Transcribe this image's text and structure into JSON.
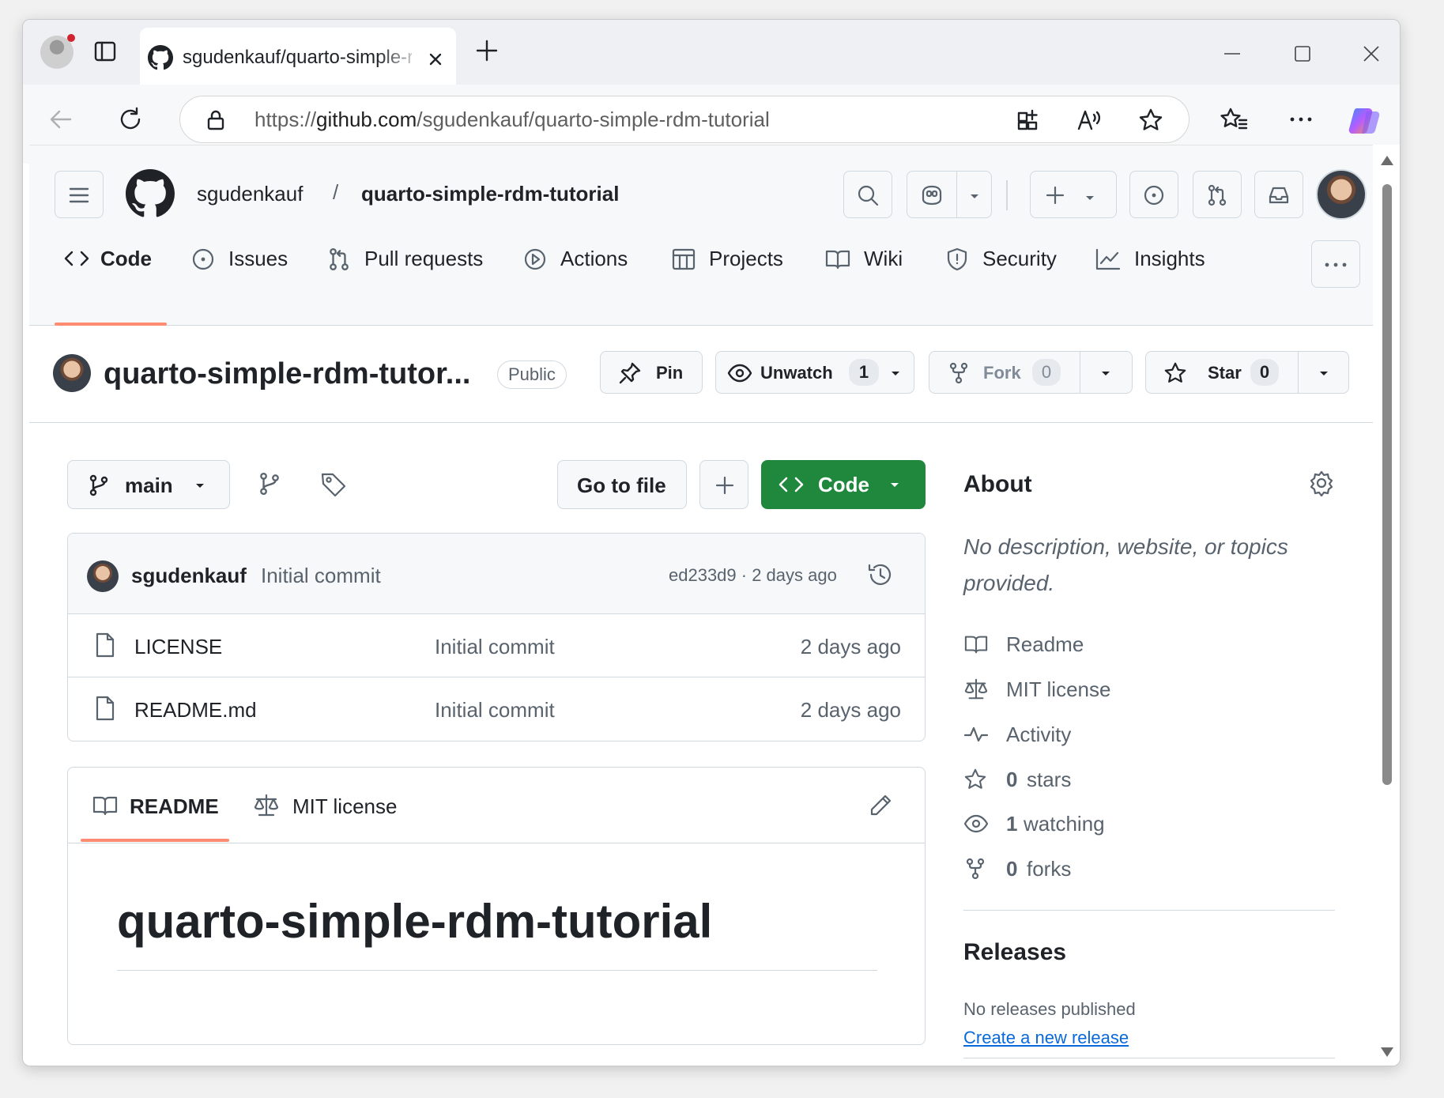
{
  "browser": {
    "tab_title": "sgudenkauf/quarto-simple-rdm-t",
    "url_prefix": "https://",
    "url_host": "github.com",
    "url_path": "/sgudenkauf/quarto-simple-rdm-tutorial"
  },
  "header": {
    "owner": "sgudenkauf",
    "separator": "/",
    "repo": "quarto-simple-rdm-tutorial"
  },
  "nav": {
    "tabs": [
      {
        "label": "Code"
      },
      {
        "label": "Issues"
      },
      {
        "label": "Pull requests"
      },
      {
        "label": "Actions"
      },
      {
        "label": "Projects"
      },
      {
        "label": "Wiki"
      },
      {
        "label": "Security"
      },
      {
        "label": "Insights"
      }
    ]
  },
  "repo_header": {
    "title": "quarto-simple-rdm-tutor...",
    "visibility": "Public",
    "pin_label": "Pin",
    "unwatch_label": "Unwatch",
    "watch_count": "1",
    "fork_label": "Fork",
    "fork_count": "0",
    "star_label": "Star",
    "star_count": "0"
  },
  "file_nav": {
    "branch": "main",
    "go_to_file": "Go to file",
    "code_button": "Code"
  },
  "commit": {
    "author": "sgudenkauf",
    "message": "Initial commit",
    "meta": "ed233d9 · 2 days ago"
  },
  "files": [
    {
      "name": "LICENSE",
      "message": "Initial commit",
      "age": "2 days ago"
    },
    {
      "name": "README.md",
      "message": "Initial commit",
      "age": "2 days ago"
    }
  ],
  "readme": {
    "tab_readme": "README",
    "tab_license": "MIT license",
    "heading": "quarto-simple-rdm-tutorial"
  },
  "about": {
    "title": "About",
    "description_line1": "No description, website, or topics",
    "description_line2": "provided.",
    "readme": "Readme",
    "license": "MIT license",
    "activity": "Activity",
    "stars_num": "0",
    "stars_label": "stars",
    "watching_num": "1",
    "watching_label": "watching",
    "forks_num": "0",
    "forks_label": "forks"
  },
  "releases": {
    "title": "Releases",
    "none": "No releases published",
    "create_link": "Create a new release"
  },
  "colors": {
    "accent_underline": "#fd8c73",
    "green_button": "#1f883d",
    "link_blue": "#0969da"
  }
}
